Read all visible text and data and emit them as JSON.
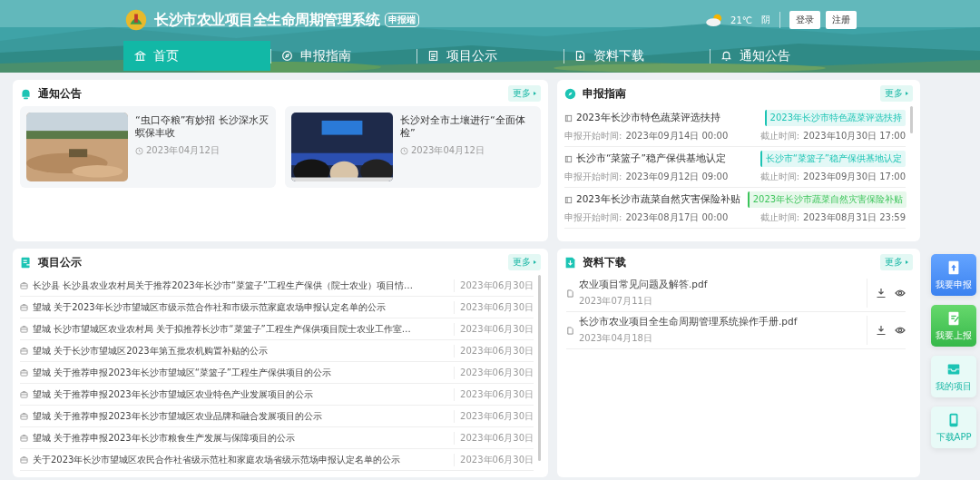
{
  "header": {
    "title": "长沙市农业项目全生命周期管理系统",
    "badge": "申报端",
    "weather": {
      "temp": "21℃",
      "desc": "阴"
    },
    "buttons": [
      "登录",
      "注册"
    ]
  },
  "nav": [
    {
      "label": "首页",
      "selected": true
    },
    {
      "label": "申报指南",
      "selected": false
    },
    {
      "label": "项目公示",
      "selected": false
    },
    {
      "label": "资料下载",
      "selected": false
    },
    {
      "label": "通知公告",
      "selected": false
    }
  ],
  "notices": {
    "title": "通知公告",
    "more": "更多",
    "items": [
      {
        "title": "“虫口夺粮”有妙招 长沙深水灭螟保丰收",
        "date": "2023年04月12日",
        "kind": "picture"
      },
      {
        "title": "长沙对全市土壤进行“全面体检”",
        "date": "2023年04月12日",
        "kind": "picture"
      }
    ]
  },
  "guides": {
    "title": "申报指南",
    "more": "更多",
    "items": [
      {
        "title": "2023年长沙市特色蔬菜评选扶持",
        "tag": "2023年长沙市特色蔬菜评选扶持",
        "color": "#1cc4b4",
        "start_label": "申报开始时间:",
        "start": "2023年09月14日 00:00",
        "end_label": "截止时间:",
        "end": "2023年10月30日 17:00"
      },
      {
        "title": "长沙市“菜篮子”稳产保供基地认定",
        "tag": "长沙市“菜篮子”稳产保供基地认定",
        "color": "#1cc4b4",
        "start_label": "申报开始时间:",
        "start": "2023年09月12日 09:00",
        "end_label": "截止时间:",
        "end": "2023年09月30日 17:00"
      },
      {
        "title": "2023年长沙市蔬菜自然灾害保险补贴",
        "tag": "2023年长沙市蔬菜自然灾害保险补贴",
        "color": "#3cc45a",
        "start_label": "申报开始时间:",
        "start": "2023年08月17日 00:00",
        "end_label": "截止时间:",
        "end": "2023年08月31日 23:59"
      }
    ]
  },
  "projects": {
    "title": "项目公示",
    "more": "更多",
    "items": [
      {
        "title": "长沙县 长沙县农业农村局关于推荐2023年长沙市“菜篮子”工程生产保供（院士农业）项目情…",
        "date": "2023年06月30日"
      },
      {
        "title": "望城 关于2023年长沙市望城区市级示范合作社和市级示范家庭农场申报认定名单的公示",
        "date": "2023年06月30日"
      },
      {
        "title": "望城 长沙市望城区农业农村局 关于拟推荐长沙市“菜篮子”工程生产保供项目院士农业工作室…",
        "date": "2023年06月30日"
      },
      {
        "title": "望城 关于长沙市望城区2023年第五批农机购置补贴的公示",
        "date": "2023年06月30日"
      },
      {
        "title": "望城 关于推荐申报2023年长沙市望城区“菜篮子”工程生产保供项目的公示",
        "date": "2023年06月30日"
      },
      {
        "title": "望城 关于推荐申报2023年长沙市望城区农业特色产业发展项目的公示",
        "date": "2023年06月30日"
      },
      {
        "title": "望城 关于推荐申报2023年长沙市望城区农业品牌和融合发展项目的公示",
        "date": "2023年06月30日"
      },
      {
        "title": "望城 关于推荐申报2023年长沙市粮食生产发展与保障项目的公示",
        "date": "2023年06月30日"
      },
      {
        "title": "关于2023年长沙市望城区农民合作社省级示范社和家庭农场省级示范场申报认定名单的公示",
        "date": "2023年06月30日"
      }
    ]
  },
  "downloads": {
    "title": "资料下载",
    "more": "更多",
    "items": [
      {
        "name": "农业项目常见问题及解答.pdf",
        "date": "2023年07月11日"
      },
      {
        "name": "长沙市农业项目全生命周期管理系统操作手册.pdf",
        "date": "2023年04月18日"
      }
    ]
  },
  "side": [
    {
      "label": "我要申报",
      "kind": "blue"
    },
    {
      "label": "我要上报",
      "kind": "green"
    },
    {
      "label": "我的项目",
      "kind": "light"
    },
    {
      "label": "下载APP",
      "kind": "light"
    }
  ]
}
